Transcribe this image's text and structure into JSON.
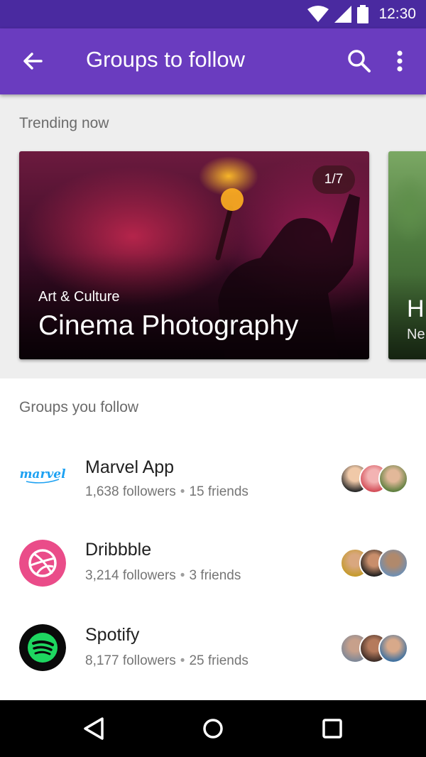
{
  "status_bar": {
    "time": "12:30",
    "icons": [
      "wifi-icon",
      "signal-icon",
      "battery-icon"
    ]
  },
  "app_bar": {
    "title": "Groups to follow",
    "icons": [
      "back-arrow-icon",
      "search-icon",
      "more-vert-icon"
    ],
    "color": "#6a3cbf"
  },
  "trending": {
    "label": "Trending now",
    "cards": [
      {
        "category": "Art & Culture",
        "title": "Cinema Photography",
        "page": "1/7"
      },
      {
        "title": "H",
        "subtitle": "Ne"
      }
    ]
  },
  "groups": {
    "label": "Groups you follow",
    "items": [
      {
        "name": "Marvel App",
        "followers": "1,638 followers",
        "friends": "15 friends",
        "logo_text": "marvel"
      },
      {
        "name": "Dribbble",
        "followers": "3,214 followers",
        "friends": "3 friends"
      },
      {
        "name": "Spotify",
        "followers": "8,177 followers",
        "friends": "25 friends"
      }
    ]
  },
  "nav_bar": {
    "icons": [
      "back-triangle-icon",
      "home-circle-icon",
      "recents-square-icon"
    ]
  },
  "colors": {
    "status_bar": "#4a2aa0",
    "app_bar": "#6a3cbf",
    "dribbble": "#ea4c89",
    "spotify": "#1ed760",
    "marvel": "#1da1f2"
  }
}
